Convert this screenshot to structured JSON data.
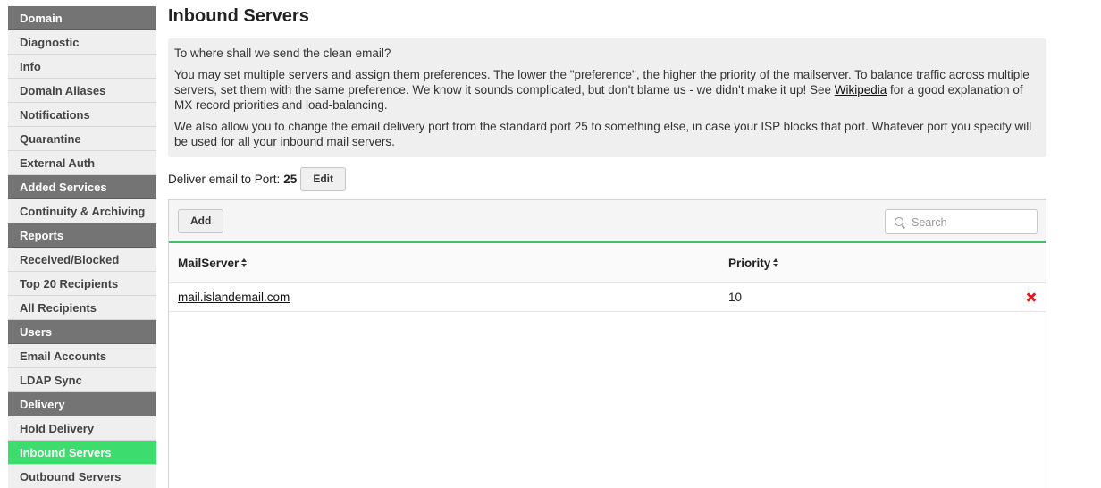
{
  "sidebar": {
    "items": [
      {
        "label": "Domain",
        "type": "header"
      },
      {
        "label": "Diagnostic",
        "type": "item"
      },
      {
        "label": "Info",
        "type": "item"
      },
      {
        "label": "Domain Aliases",
        "type": "item"
      },
      {
        "label": "Notifications",
        "type": "item"
      },
      {
        "label": "Quarantine",
        "type": "item"
      },
      {
        "label": "External Auth",
        "type": "item"
      },
      {
        "label": "Added Services",
        "type": "header"
      },
      {
        "label": "Continuity & Archiving",
        "type": "item"
      },
      {
        "label": "Reports",
        "type": "header"
      },
      {
        "label": "Received/Blocked",
        "type": "item"
      },
      {
        "label": "Top 20 Recipients",
        "type": "item"
      },
      {
        "label": "All Recipients",
        "type": "item"
      },
      {
        "label": "Users",
        "type": "header"
      },
      {
        "label": "Email Accounts",
        "type": "item"
      },
      {
        "label": "LDAP Sync",
        "type": "item"
      },
      {
        "label": "Delivery",
        "type": "header"
      },
      {
        "label": "Hold Delivery",
        "type": "item"
      },
      {
        "label": "Inbound Servers",
        "type": "item",
        "active": true
      },
      {
        "label": "Outbound Servers",
        "type": "item"
      }
    ]
  },
  "main": {
    "title": "Inbound Servers",
    "info": {
      "p1": "To where shall we send the clean email?",
      "p2_before": "You may set multiple servers and assign them preferences. The lower the \"preference\", the higher the priority of the mailserver. To balance traffic across multiple servers, set them with the same preference. We know it sounds complicated, but don't blame us - we didn't make it up! See ",
      "p2_link": "Wikipedia",
      "p2_after": " for a good explanation of MX record priorities and load-balancing.",
      "p3": "We also allow you to change the email delivery port from the standard port 25 to something else, in case your ISP blocks that port. Whatever port you specify will be used for all your inbound mail servers."
    },
    "port": {
      "label": "Deliver email to Port:",
      "value": "25",
      "edit_label": "Edit"
    },
    "toolbar": {
      "add_label": "Add",
      "search_placeholder": "Search"
    },
    "table": {
      "columns": [
        "MailServer",
        "Priority"
      ],
      "rows": [
        {
          "mailserver": "mail.islandemail.com",
          "priority": "10"
        }
      ]
    }
  },
  "colors": {
    "active": "#3ddc6e",
    "section_header": "#747474",
    "delete": "#e01b1b",
    "accent_line": "#3cc06a"
  }
}
